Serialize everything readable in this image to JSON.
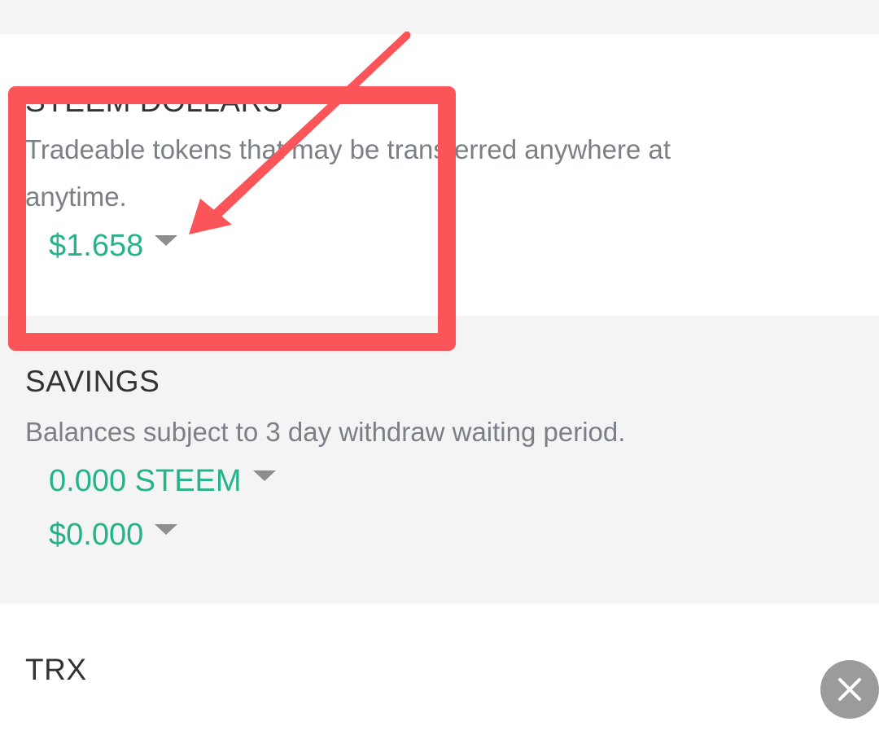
{
  "steem_dollars": {
    "title": "STEEM DOLLARS",
    "description": "Tradeable tokens that may be transferred anywhere at anytime.",
    "amount": "$1.658"
  },
  "savings": {
    "title": "SAVINGS",
    "description": "Balances subject to 3 day withdraw waiting period.",
    "steem_amount": "0.000 STEEM",
    "sbd_amount": "$0.000"
  },
  "trx": {
    "title": "TRX"
  },
  "colors": {
    "accent_green": "#24b38a",
    "highlight_red": "#fb5459",
    "caret_gray": "#8e8e8e",
    "fab_gray": "#9b9b9b"
  },
  "icons": {
    "dropdown": "caret-down-icon",
    "close": "close-icon",
    "annotation_arrow": "arrow-icon"
  }
}
